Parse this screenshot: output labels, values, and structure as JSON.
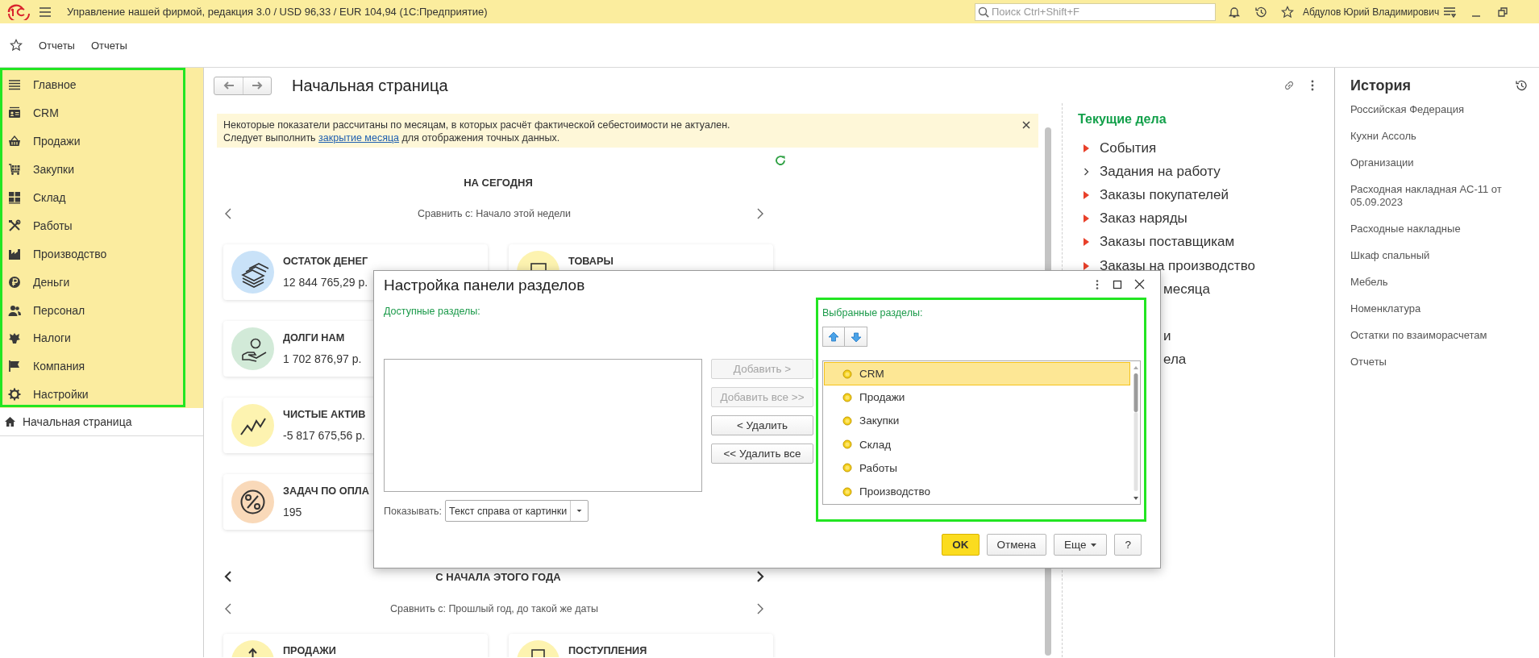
{
  "app_bar": {
    "title": "Управление нашей фирмой, редакция 3.0 / USD 96,33 / EUR 104,94  (1С:Предприятие)",
    "search": {
      "placeholder": "Поиск Ctrl+Shift+F"
    },
    "user": "Абдулов Юрий Владимирович"
  },
  "favorites": [
    "Отчеты",
    "Отчеты"
  ],
  "sidebar": {
    "highlighted": true,
    "items": [
      {
        "label": "Главное"
      },
      {
        "label": "CRM"
      },
      {
        "label": "Продажи"
      },
      {
        "label": "Закупки"
      },
      {
        "label": "Склад"
      },
      {
        "label": "Работы"
      },
      {
        "label": "Производство"
      },
      {
        "label": "Деньги"
      },
      {
        "label": "Персонал"
      },
      {
        "label": "Налоги"
      },
      {
        "label": "Компания"
      },
      {
        "label": "Настройки"
      }
    ]
  },
  "open_windows": [
    {
      "label": "Начальная страница"
    }
  ],
  "page": {
    "title": "Начальная страница",
    "notice": {
      "line_1": "Некоторые показатели рассчитаны по месяцам, в которых расчёт фактической себестоимости не актуален.",
      "line_2_before": "Следует выполнить ",
      "link": "закрытие месяца",
      "line_2_after": " для отображения точных данных."
    },
    "sections": [
      {
        "title": "НА СЕГОДНЯ",
        "title_arrows": false,
        "compare": "Сравнить с: Начало этой недели",
        "rows": [
          [
            {
              "title": "ОСТАТОК ДЕНЕГ",
              "value": "12 844 765,29 р.",
              "color": "#c9e2f8"
            },
            {
              "title": "ТОВАРЫ",
              "color": "#fdf3b0"
            }
          ],
          [
            {
              "title": "ДОЛГИ НАМ",
              "value": "1 702 876,97 р.",
              "color": "#d2ead8"
            }
          ],
          [
            {
              "title": "ЧИСТЫЕ АКТИВ",
              "value": "-5 817 675,56 р.",
              "color": "#fdf3b0"
            }
          ],
          [
            {
              "title": "ЗАДАЧ ПО ОПЛА",
              "value": "195",
              "color": "#f9d9b9"
            }
          ]
        ]
      },
      {
        "title": "С НАЧАЛА ЭТОГО ГОДА",
        "title_arrows": true,
        "compare": "Сравнить с: Прошлый год, до такой же даты",
        "rows": [
          [
            {
              "title": "ПРОДАЖИ",
              "color": "#fdf3b0"
            },
            {
              "title": "ПОСТУПЛЕНИЯ",
              "color": "#fdf3b0"
            }
          ]
        ]
      }
    ],
    "todo": {
      "title": "Текущие дела",
      "items": [
        {
          "label": "События",
          "kind": "alert"
        },
        {
          "label": "Задания на работу",
          "kind": "plain"
        },
        {
          "label": "Заказы покупателей",
          "kind": "alert"
        },
        {
          "label": "Заказ наряды",
          "kind": "alert"
        },
        {
          "label": "Заказы поставщикам",
          "kind": "alert"
        },
        {
          "label": "Заказы на производство",
          "kind": "alert"
        },
        {
          "label": "месяца",
          "kind": "partial"
        },
        {
          "label": "и",
          "kind": "partial",
          "gap_before": true
        },
        {
          "label": "ела",
          "kind": "partial"
        }
      ]
    }
  },
  "history": {
    "title": "История",
    "items": [
      "Российская Федерация",
      "Кухни Ассоль",
      "Организации",
      "Расходная накладная АС-11 от 05.09.2023",
      "Расходные накладные",
      "Шкаф спальный",
      "Мебель",
      "Номенклатура",
      "Остатки по взаиморасчетам",
      "Отчеты"
    ]
  },
  "dialog": {
    "title": "Настройка панели разделов",
    "available": {
      "label": "Доступные разделы:"
    },
    "move_buttons": [
      {
        "label": "Добавить >",
        "disabled": true
      },
      {
        "label": "Добавить все >>",
        "disabled": true
      },
      {
        "label": "< Удалить",
        "disabled": false
      },
      {
        "label": "<< Удалить все",
        "disabled": false
      }
    ],
    "chosen": {
      "label": "Выбранные разделы:",
      "highlighted": true,
      "items": [
        {
          "label": "CRM",
          "selected": true
        },
        {
          "label": "Продажи",
          "selected": false
        },
        {
          "label": "Закупки",
          "selected": false
        },
        {
          "label": "Склад",
          "selected": false
        },
        {
          "label": "Работы",
          "selected": false
        },
        {
          "label": "Производство",
          "selected": false
        }
      ]
    },
    "show": {
      "label": "Показывать:",
      "value": "Текст справа от картинки"
    },
    "buttons": [
      {
        "label": "OK",
        "kind": "default"
      },
      {
        "label": "Отмена",
        "kind": "normal"
      },
      {
        "label": "Еще",
        "kind": "menu"
      },
      {
        "label": "?",
        "kind": "normal"
      }
    ]
  }
}
